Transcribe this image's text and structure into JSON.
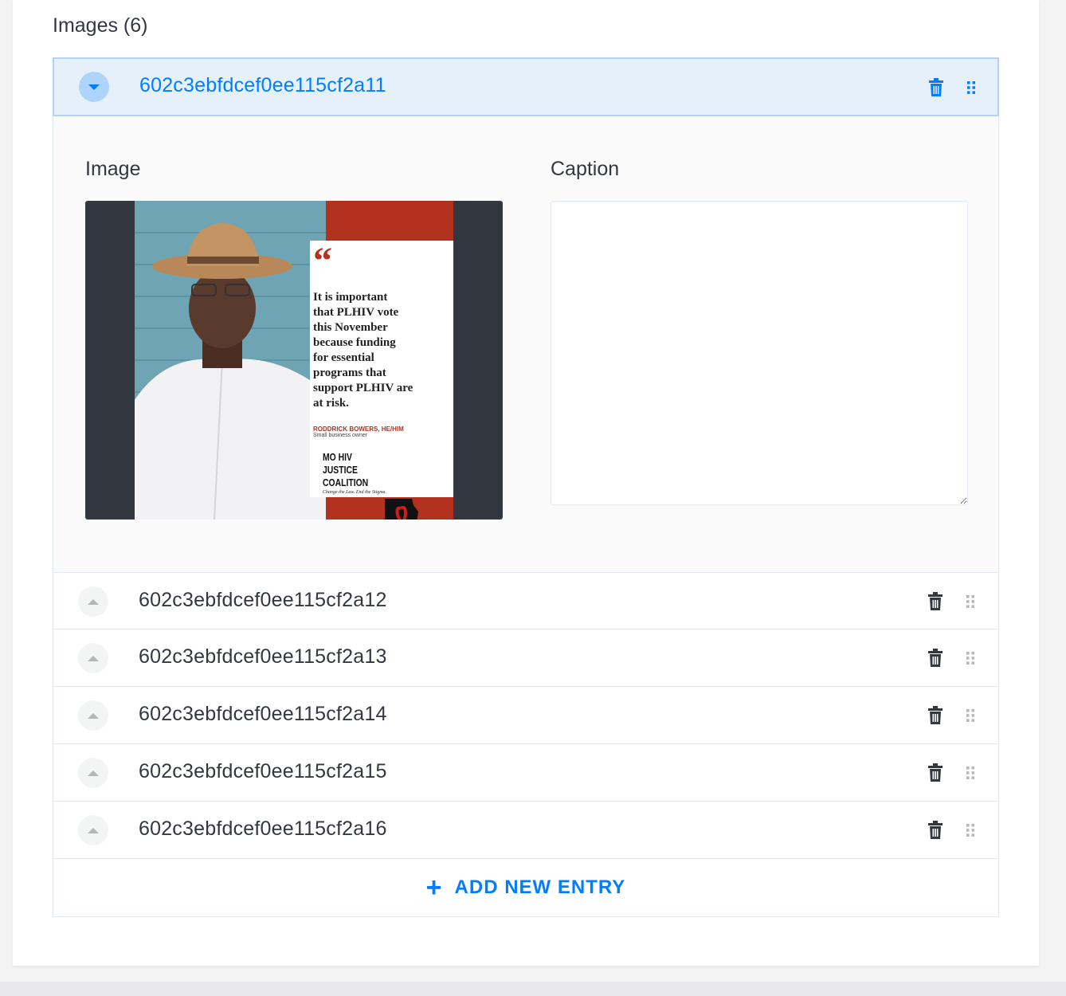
{
  "section": {
    "title": "Images (6)"
  },
  "entries": [
    {
      "id": "602c3ebfdcef0ee115cf2a11",
      "expanded": true
    },
    {
      "id": "602c3ebfdcef0ee115cf2a12",
      "expanded": false
    },
    {
      "id": "602c3ebfdcef0ee115cf2a13",
      "expanded": false
    },
    {
      "id": "602c3ebfdcef0ee115cf2a14",
      "expanded": false
    },
    {
      "id": "602c3ebfdcef0ee115cf2a15",
      "expanded": false
    },
    {
      "id": "602c3ebfdcef0ee115cf2a16",
      "expanded": false
    }
  ],
  "panel": {
    "image_label": "Image",
    "caption_label": "Caption",
    "caption_value": "",
    "poster": {
      "quote_mark": "“",
      "quote_lines": [
        "It is important",
        "that PLHIV vote",
        "this November",
        "because funding",
        "for essential",
        "programs that",
        "support PLHIV are",
        "at risk."
      ],
      "author": "RODDRICK BOWERS, HE/HIM",
      "author_role": "Small business owner",
      "logo_line1": "MO HIV",
      "logo_line2": "JUSTICE",
      "logo_line3": "COALITION",
      "tagline": "Change the Law. End the Stigma."
    }
  },
  "add_entry": {
    "icon": "plus-icon",
    "label": "ADD NEW ENTRY"
  },
  "colors": {
    "accent": "#007eff",
    "open_row_bg": "#e6f0fb",
    "open_row_border": "#aed4fb",
    "poster_red": "#b3311f"
  }
}
